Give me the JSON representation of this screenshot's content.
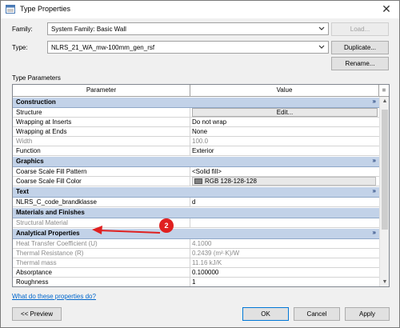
{
  "window": {
    "title": "Type Properties",
    "close_glyph": "✕"
  },
  "family": {
    "label": "Family:",
    "value": "System Family: Basic Wall",
    "load_label": "Load..."
  },
  "type": {
    "label": "Type:",
    "value": "NLRS_21_WA_mw-100mm_gen_rsf",
    "duplicate_label": "Duplicate...",
    "rename_label": "Rename..."
  },
  "section_label": "Type Parameters",
  "grid": {
    "col_parameter": "Parameter",
    "col_value": "Value",
    "col_equals": "=",
    "groups": [
      {
        "name": "Construction",
        "chevron": "»",
        "rows": [
          {
            "param": "Structure",
            "value": "Edit...",
            "kind": "button"
          },
          {
            "param": "Wrapping at Inserts",
            "value": "Do not wrap"
          },
          {
            "param": "Wrapping at Ends",
            "value": "None"
          },
          {
            "param": "Width",
            "value": "100.0",
            "grey": true
          },
          {
            "param": "Function",
            "value": "Exterior"
          }
        ]
      },
      {
        "name": "Graphics",
        "chevron": "»",
        "rows": [
          {
            "param": "Coarse Scale Fill Pattern",
            "value": "<Solid fill>"
          },
          {
            "param": "Coarse Scale Fill Color",
            "value": "RGB 128-128-128",
            "kind": "color",
            "color": "#808080"
          }
        ]
      },
      {
        "name": "Text",
        "chevron": "»",
        "rows": [
          {
            "param": "NLRS_C_code_brandklasse",
            "value": "d"
          }
        ]
      },
      {
        "name": "Materials and Finishes",
        "chevron": "",
        "rows": [
          {
            "param": "Structural Material",
            "value": "",
            "grey": true
          }
        ]
      },
      {
        "name": "Analytical Properties",
        "chevron": "»",
        "rows": [
          {
            "param": "Heat Transfer Coefficient (U)",
            "value": "4.1000",
            "grey": true
          },
          {
            "param": "Thermal Resistance (R)",
            "value": "0.2439 (m²·K)/W",
            "grey": true
          },
          {
            "param": "Thermal mass",
            "value": "11.16 kJ/K",
            "grey": true
          },
          {
            "param": "Absorptance",
            "value": "0.100000"
          },
          {
            "param": "Roughness",
            "value": "1"
          }
        ]
      }
    ]
  },
  "help_link": "What do these properties do?",
  "buttons": {
    "preview": "<< Preview",
    "ok": "OK",
    "cancel": "Cancel",
    "apply": "Apply"
  },
  "annotation": {
    "badge": "2",
    "color": "#e02020"
  }
}
